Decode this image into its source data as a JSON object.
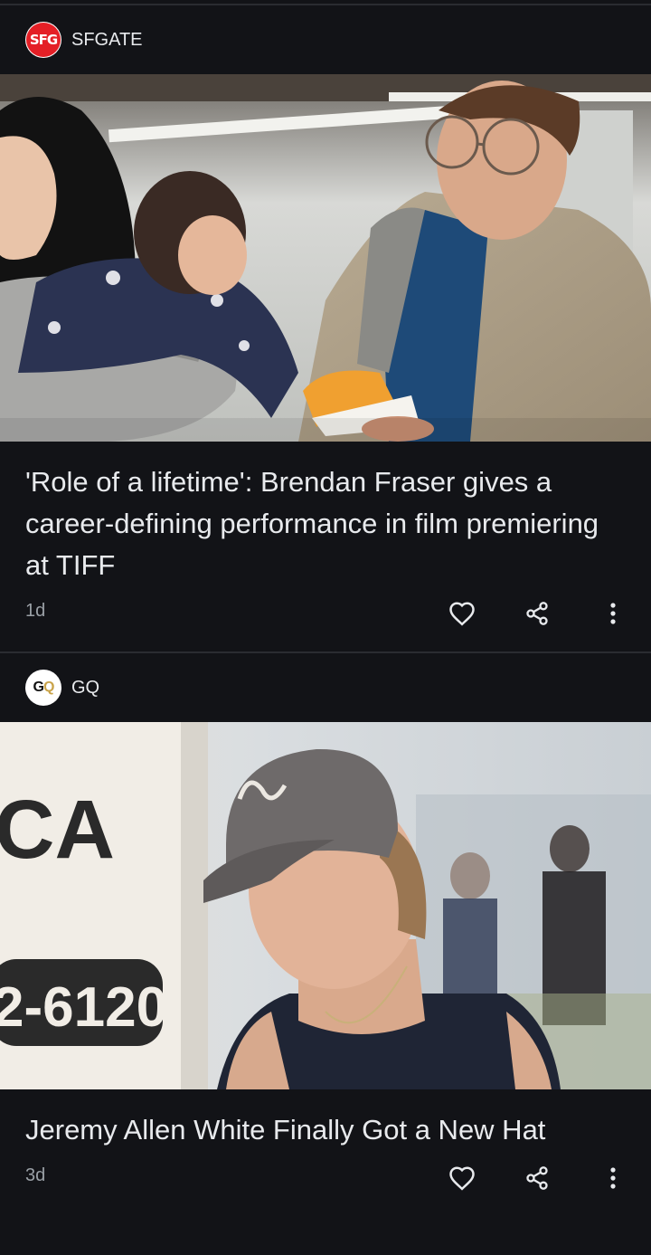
{
  "articles": [
    {
      "source": {
        "name": "SFGATE",
        "logo_text": "SFG",
        "logo_color": "#e41f26"
      },
      "image": {
        "icon": "photo-brendan-fraser-icon"
      },
      "headline": "'Role of a lifetime': Brendan Fraser gives a career-defining performance in film premiering at TIFF",
      "age": "1d",
      "actions": {
        "like_icon": "heart-icon",
        "share_icon": "share-icon",
        "more_icon": "more-vert-icon"
      }
    },
    {
      "source": {
        "name": "GQ",
        "logo_text_g": "G",
        "logo_text_q": "Q",
        "logo_accent": "#c9a34a"
      },
      "image": {
        "icon": "photo-jeremy-allen-white-icon",
        "sign_text_1": "CA",
        "sign_text_2": "2-6120"
      },
      "headline": "Jeremy Allen White Finally Got a New Hat",
      "age": "3d",
      "actions": {
        "like_icon": "heart-icon",
        "share_icon": "share-icon",
        "more_icon": "more-vert-icon"
      }
    }
  ],
  "theme": {
    "background": "#121317",
    "text": "#e8eaed",
    "muted": "#9aa0a6",
    "divider": "#2a2c31"
  }
}
